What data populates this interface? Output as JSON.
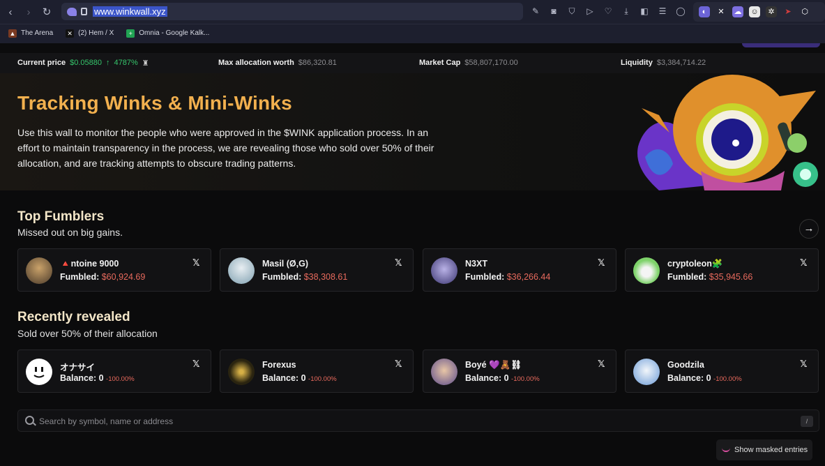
{
  "browser": {
    "url": "www.winkwall.xyz",
    "bookmarks": [
      {
        "label": "The Arena"
      },
      {
        "label": "(2) Hem / X"
      },
      {
        "label": "Omnia - Google Kalk..."
      }
    ]
  },
  "stats": {
    "current_price_label": "Current price",
    "current_price_value": "$0.05880",
    "current_price_change": "4787%",
    "max_alloc_label": "Max allocation worth",
    "max_alloc_value": "$86,320.81",
    "market_cap_label": "Market Cap",
    "market_cap_value": "$58,807,170.00",
    "liquidity_label": "Liquidity",
    "liquidity_value": "$3,384,714.22"
  },
  "hero": {
    "title": "Tracking Winks & Mini-Winks",
    "description": "Use this wall to monitor the people who were approved in the $WINK application process. In an effort to maintain transparency in the process, we are revealing those who sold over 50% of their allocation, and are tracking attempts to obscure trading patterns."
  },
  "fumblers": {
    "title": "Top Fumblers",
    "subtitle": "Missed out on big gains.",
    "label": "Fumbled:",
    "items": [
      {
        "name": "🔺ntoine 9000",
        "amount": "$60,924.69"
      },
      {
        "name": "Masil (Ø,G)",
        "amount": "$38,308.61"
      },
      {
        "name": "N3XT",
        "amount": "$36,266.44"
      },
      {
        "name": "cryptoleon🧩",
        "amount": "$35,945.66"
      }
    ]
  },
  "revealed": {
    "title": "Recently revealed",
    "subtitle": "Sold over 50% of their allocation",
    "label": "Balance:",
    "items": [
      {
        "name": "オナサイ",
        "balance": "0",
        "pct": "-100.00%"
      },
      {
        "name": "Forexus",
        "balance": "0",
        "pct": "-100.00%"
      },
      {
        "name": "Boyé 💜🧸⛓",
        "balance": "0",
        "pct": "-100.00%"
      },
      {
        "name": "Goodzila",
        "balance": "0",
        "pct": "-100.00%"
      }
    ]
  },
  "search": {
    "placeholder": "Search by symbol, name or address",
    "shortcut": "/"
  },
  "masked_button": "Show masked entries"
}
